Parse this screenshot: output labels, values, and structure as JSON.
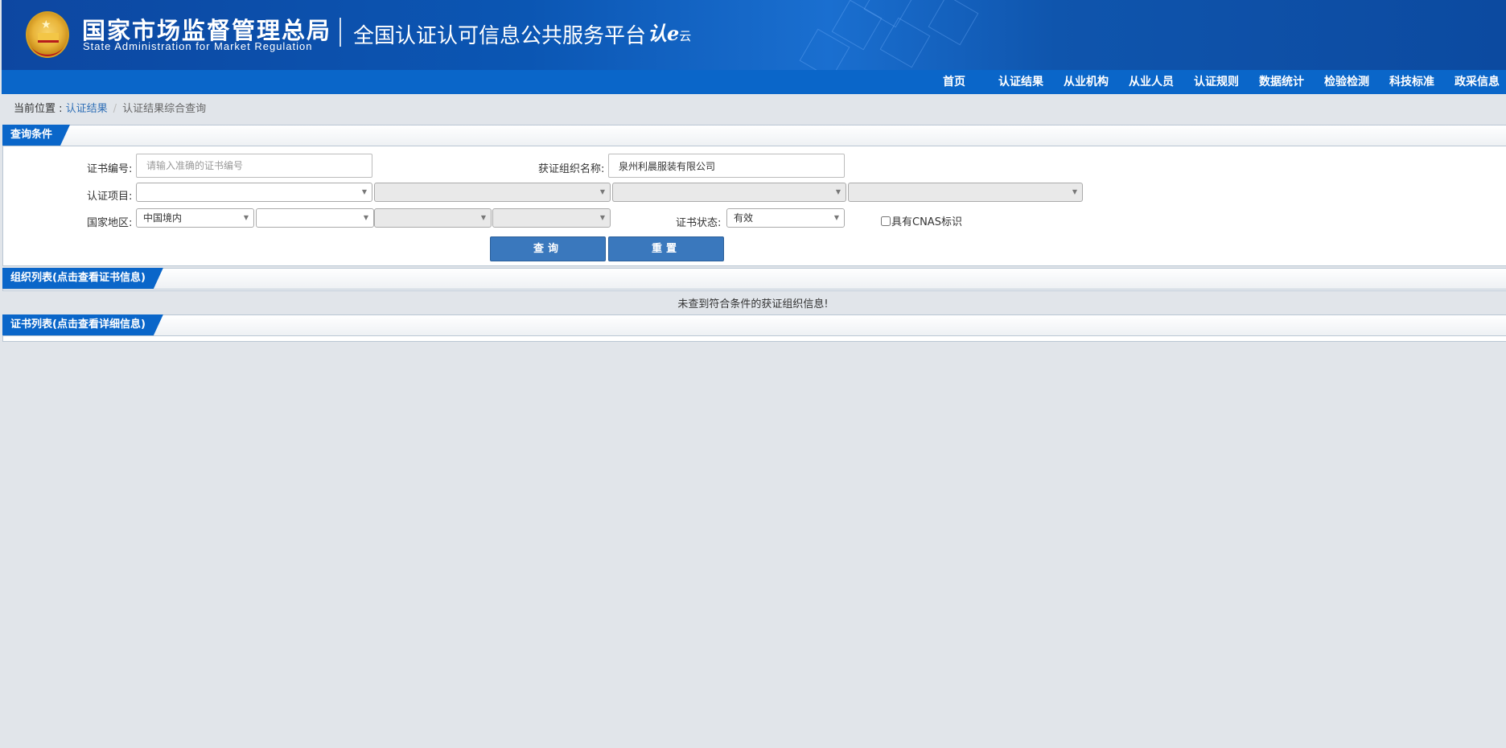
{
  "header": {
    "org_name_cn": "国家市场监督管理总局",
    "org_name_en": "State Administration  for  Market Regulation",
    "platform_title": "全国认证认可信息公共服务平台",
    "logo_text": "认e",
    "logo_sub": "云"
  },
  "nav": {
    "items": [
      "首页",
      "认证结果",
      "从业机构",
      "从业人员",
      "认证规则",
      "数据统计",
      "检验检测",
      "科技标准",
      "政采信息"
    ]
  },
  "breadcrumb": {
    "prefix": "当前位置 : ",
    "link": "认证结果",
    "separator": "/",
    "current": "认证结果综合查询"
  },
  "query_panel": {
    "title": "查询条件",
    "cert_no_label": "证书编号:",
    "cert_no_placeholder": "请输入准确的证书编号",
    "org_name_label": "获证组织名称:",
    "org_name_value": "泉州利晨服装有限公司",
    "cert_item_label": "认证项目:",
    "region_label": "国家地区:",
    "region_value": "中国境内",
    "status_label": "证书状态:",
    "status_value": "有效",
    "cnas_label": "具有CNAS标识",
    "search_button": "查询",
    "reset_button": "重置"
  },
  "org_list": {
    "title": "组织列表(点击查看证书信息)",
    "empty_message": "未查到符合条件的获证组织信息!"
  },
  "cert_list": {
    "title": "证书列表(点击查看详细信息)"
  },
  "colors": {
    "header_blue": "#0d47a1",
    "nav_blue": "#0a66c9",
    "button_blue": "#3a78bd",
    "page_bg": "#e1e5ea"
  }
}
